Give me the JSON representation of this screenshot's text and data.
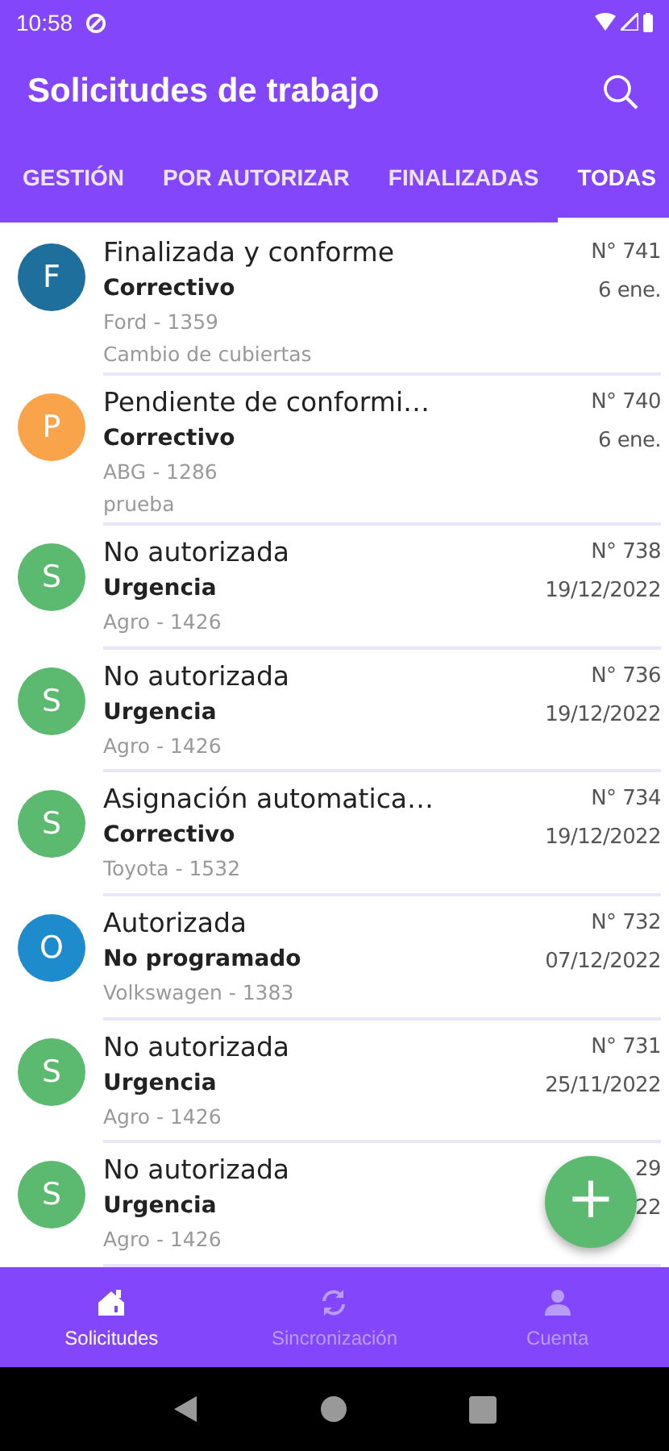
{
  "status_bar": {
    "time": "10:58"
  },
  "app_bar": {
    "title": "Solicitudes de trabajo"
  },
  "tabs": [
    {
      "label": "GESTIÓN",
      "selected": false
    },
    {
      "label": "POR AUTORIZAR",
      "selected": false
    },
    {
      "label": "FINALIZADAS",
      "selected": false
    },
    {
      "label": "TODAS",
      "selected": true
    }
  ],
  "requests": [
    {
      "avatar": "F",
      "color": "#1f6f9c",
      "title": "Finalizada y conforme",
      "type": "Correctivo",
      "vehicle": "Ford - 1359",
      "note": "Cambio de cubiertas",
      "number": "N° 741",
      "date": "6 ene."
    },
    {
      "avatar": "P",
      "color": "#f9a34a",
      "title": "Pendiente de conformi…",
      "type": "Correctivo",
      "vehicle": "ABG - 1286",
      "note": "prueba",
      "number": "N° 740",
      "date": "6 ene."
    },
    {
      "avatar": "S",
      "color": "#5cb970",
      "title": "No autorizada",
      "type": "Urgencia",
      "vehicle": "Agro - 1426",
      "number": "N° 738",
      "date": "19/12/2022"
    },
    {
      "avatar": "S",
      "color": "#5cb970",
      "title": "No autorizada",
      "type": "Urgencia",
      "vehicle": "Agro - 1426",
      "number": "N° 736",
      "date": "19/12/2022"
    },
    {
      "avatar": "S",
      "color": "#5cb970",
      "title": "Asignación automatica…",
      "type": "Correctivo",
      "vehicle": "Toyota - 1532",
      "number": "N° 734",
      "date": "19/12/2022"
    },
    {
      "avatar": "O",
      "color": "#1e8ccc",
      "title": "Autorizada",
      "type": "No programado",
      "vehicle": "Volkswagen - 1383",
      "number": "N° 732",
      "date": "07/12/2022"
    },
    {
      "avatar": "S",
      "color": "#5cb970",
      "title": "No autorizada",
      "type": "Urgencia",
      "vehicle": "Agro - 1426",
      "number": "N° 731",
      "date": "25/11/2022"
    },
    {
      "avatar": "S",
      "color": "#5cb970",
      "title": "No autorizada",
      "type": "Urgencia",
      "vehicle": "Agro - 1426",
      "number": "29",
      "date": "22"
    }
  ],
  "fab": {
    "label": "+"
  },
  "bottom_nav": [
    {
      "kind": "home",
      "label": "Solicitudes",
      "selected": true
    },
    {
      "kind": "sync",
      "label": "Sincronización",
      "selected": false
    },
    {
      "kind": "person",
      "label": "Cuenta",
      "selected": false
    }
  ]
}
